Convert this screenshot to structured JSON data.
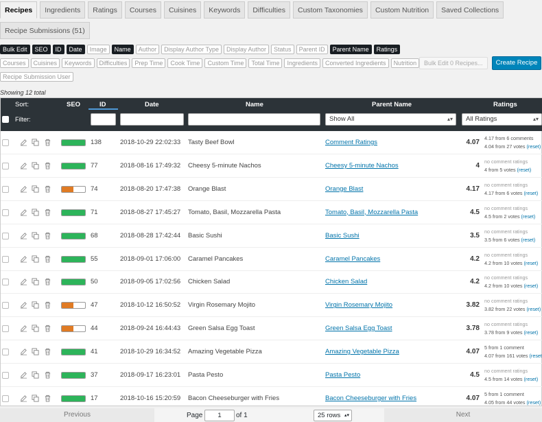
{
  "tabs": [
    "Recipes",
    "Ingredients",
    "Ratings",
    "Courses",
    "Cuisines",
    "Keywords",
    "Difficulties",
    "Custom Taxonomies",
    "Custom Nutrition",
    "Saved Collections"
  ],
  "tab_submissions": "Recipe Submissions (51)",
  "column_chips_row1": [
    {
      "label": "Bulk Edit",
      "on": true
    },
    {
      "label": "SEO",
      "on": true
    },
    {
      "label": "ID",
      "on": true
    },
    {
      "label": "Date",
      "on": true
    },
    {
      "label": "Image",
      "on": false
    },
    {
      "label": "Name",
      "on": true
    },
    {
      "label": "Author",
      "on": false
    },
    {
      "label": "Display Author Type",
      "on": false
    },
    {
      "label": "Display Author",
      "on": false
    },
    {
      "label": "Status",
      "on": false
    },
    {
      "label": "Parent ID",
      "on": false
    },
    {
      "label": "Parent Name",
      "on": true
    },
    {
      "label": "Ratings",
      "on": true
    }
  ],
  "column_chips_row2": [
    {
      "label": "Courses",
      "on": false
    },
    {
      "label": "Cuisines",
      "on": false
    },
    {
      "label": "Keywords",
      "on": false
    },
    {
      "label": "Difficulties",
      "on": false
    },
    {
      "label": "Prep Time",
      "on": false
    },
    {
      "label": "Cook Time",
      "on": false
    },
    {
      "label": "Custom Time",
      "on": false
    },
    {
      "label": "Total Time",
      "on": false
    },
    {
      "label": "Ingredients",
      "on": false
    },
    {
      "label": "Converted Ingredients",
      "on": false
    },
    {
      "label": "Nutrition",
      "on": false
    }
  ],
  "column_chips_row3": [
    {
      "label": "Recipe Submission User",
      "on": false
    }
  ],
  "bulk_edit_button": "Bulk Edit 0 Recipes...",
  "create_recipe_button": "Create Recipe",
  "showing_text": "Showing 12 total",
  "headers": {
    "sort": "Sort:",
    "seo": "SEO",
    "id": "ID",
    "date": "Date",
    "name": "Name",
    "parent_name": "Parent Name",
    "ratings": "Ratings"
  },
  "filter_label": "Filter:",
  "filters": {
    "parent_select": "Show All",
    "ratings_select": "All Ratings"
  },
  "seo_colors": {
    "good": "#2db45a",
    "ok": "#e07b24"
  },
  "action_icons": [
    "edit-icon",
    "duplicate-icon",
    "trash-icon"
  ],
  "rows": [
    {
      "seo": "good",
      "id": "138",
      "date": "2018-10-29 22:02:33",
      "name": "Tasty Beef Bowl",
      "parent": "Comment Ratings",
      "rating": "4.07",
      "line1": "4.17 from 6 comments",
      "line1_nc": false,
      "line2": "4.04 from 27 votes",
      "reset": "(reset)"
    },
    {
      "seo": "good",
      "id": "77",
      "date": "2018-08-16 17:49:32",
      "name": "Cheesy 5-minute Nachos",
      "parent": "Cheesy 5-minute Nachos",
      "rating": "4",
      "line1": "no comment ratings",
      "line1_nc": true,
      "line2": "4 from 5 votes",
      "reset": "(reset)"
    },
    {
      "seo": "ok",
      "id": "74",
      "date": "2018-08-20 17:47:38",
      "name": "Orange Blast",
      "parent": "Orange Blast",
      "rating": "4.17",
      "line1": "no comment ratings",
      "line1_nc": true,
      "line2": "4.17 from 6 votes",
      "reset": "(reset)"
    },
    {
      "seo": "good",
      "id": "71",
      "date": "2018-08-27 17:45:27",
      "name": "Tomato, Basil, Mozzarella Pasta",
      "parent": "Tomato, Basil, Mozzarella Pasta",
      "rating": "4.5",
      "line1": "no comment ratings",
      "line1_nc": true,
      "line2": "4.5 from 2 votes",
      "reset": "(reset)"
    },
    {
      "seo": "good",
      "id": "68",
      "date": "2018-08-28 17:42:44",
      "name": "Basic Sushi",
      "parent": "Basic Sushi",
      "rating": "3.5",
      "line1": "no comment ratings",
      "line1_nc": true,
      "line2": "3.5 from 6 votes",
      "reset": "(reset)"
    },
    {
      "seo": "good",
      "id": "55",
      "date": "2018-09-01 17:06:00",
      "name": "Caramel Pancakes",
      "parent": "Caramel Pancakes",
      "rating": "4.2",
      "line1": "no comment ratings",
      "line1_nc": true,
      "line2": "4.2 from 10 votes",
      "reset": "(reset)"
    },
    {
      "seo": "good",
      "id": "50",
      "date": "2018-09-05 17:02:56",
      "name": "Chicken Salad",
      "parent": "Chicken Salad",
      "rating": "4.2",
      "line1": "no comment ratings",
      "line1_nc": true,
      "line2": "4.2 from 10 votes",
      "reset": "(reset)"
    },
    {
      "seo": "ok",
      "id": "47",
      "date": "2018-10-12 16:50:52",
      "name": "Virgin Rosemary Mojito",
      "parent": "Virgin Rosemary Mojito",
      "rating": "3.82",
      "line1": "no comment ratings",
      "line1_nc": true,
      "line2": "3.82 from 22 votes",
      "reset": "(reset)"
    },
    {
      "seo": "ok",
      "id": "44",
      "date": "2018-09-24 16:44:43",
      "name": "Green Salsa Egg Toast",
      "parent": "Green Salsa Egg Toast",
      "rating": "3.78",
      "line1": "no comment ratings",
      "line1_nc": true,
      "line2": "3.78 from 9 votes",
      "reset": "(reset)"
    },
    {
      "seo": "good",
      "id": "41",
      "date": "2018-10-29 16:34:52",
      "name": "Amazing Vegetable Pizza",
      "parent": "Amazing Vegetable Pizza",
      "rating": "4.07",
      "line1": "5 from 1 comment",
      "line1_nc": false,
      "line2": "4.07 from 161 votes",
      "reset": "(reset)"
    },
    {
      "seo": "good",
      "id": "37",
      "date": "2018-09-17 16:23:01",
      "name": "Pasta Pesto",
      "parent": "Pasta Pesto",
      "rating": "4.5",
      "line1": "no comment ratings",
      "line1_nc": true,
      "line2": "4.5 from 14 votes",
      "reset": "(reset)"
    },
    {
      "seo": "good",
      "id": "17",
      "date": "2018-10-16 15:20:59",
      "name": "Bacon Cheeseburger with Fries",
      "parent": "Bacon Cheeseburger with Fries",
      "rating": "4.07",
      "line1": "5 from 1 comment",
      "line1_nc": false,
      "line2": "4.05 from 44 votes",
      "reset": "(reset)"
    }
  ],
  "pager": {
    "previous": "Previous",
    "page_label": "Page",
    "page_value": "1",
    "of_label": "of 1",
    "rows_select": "25 rows",
    "next": "Next"
  }
}
